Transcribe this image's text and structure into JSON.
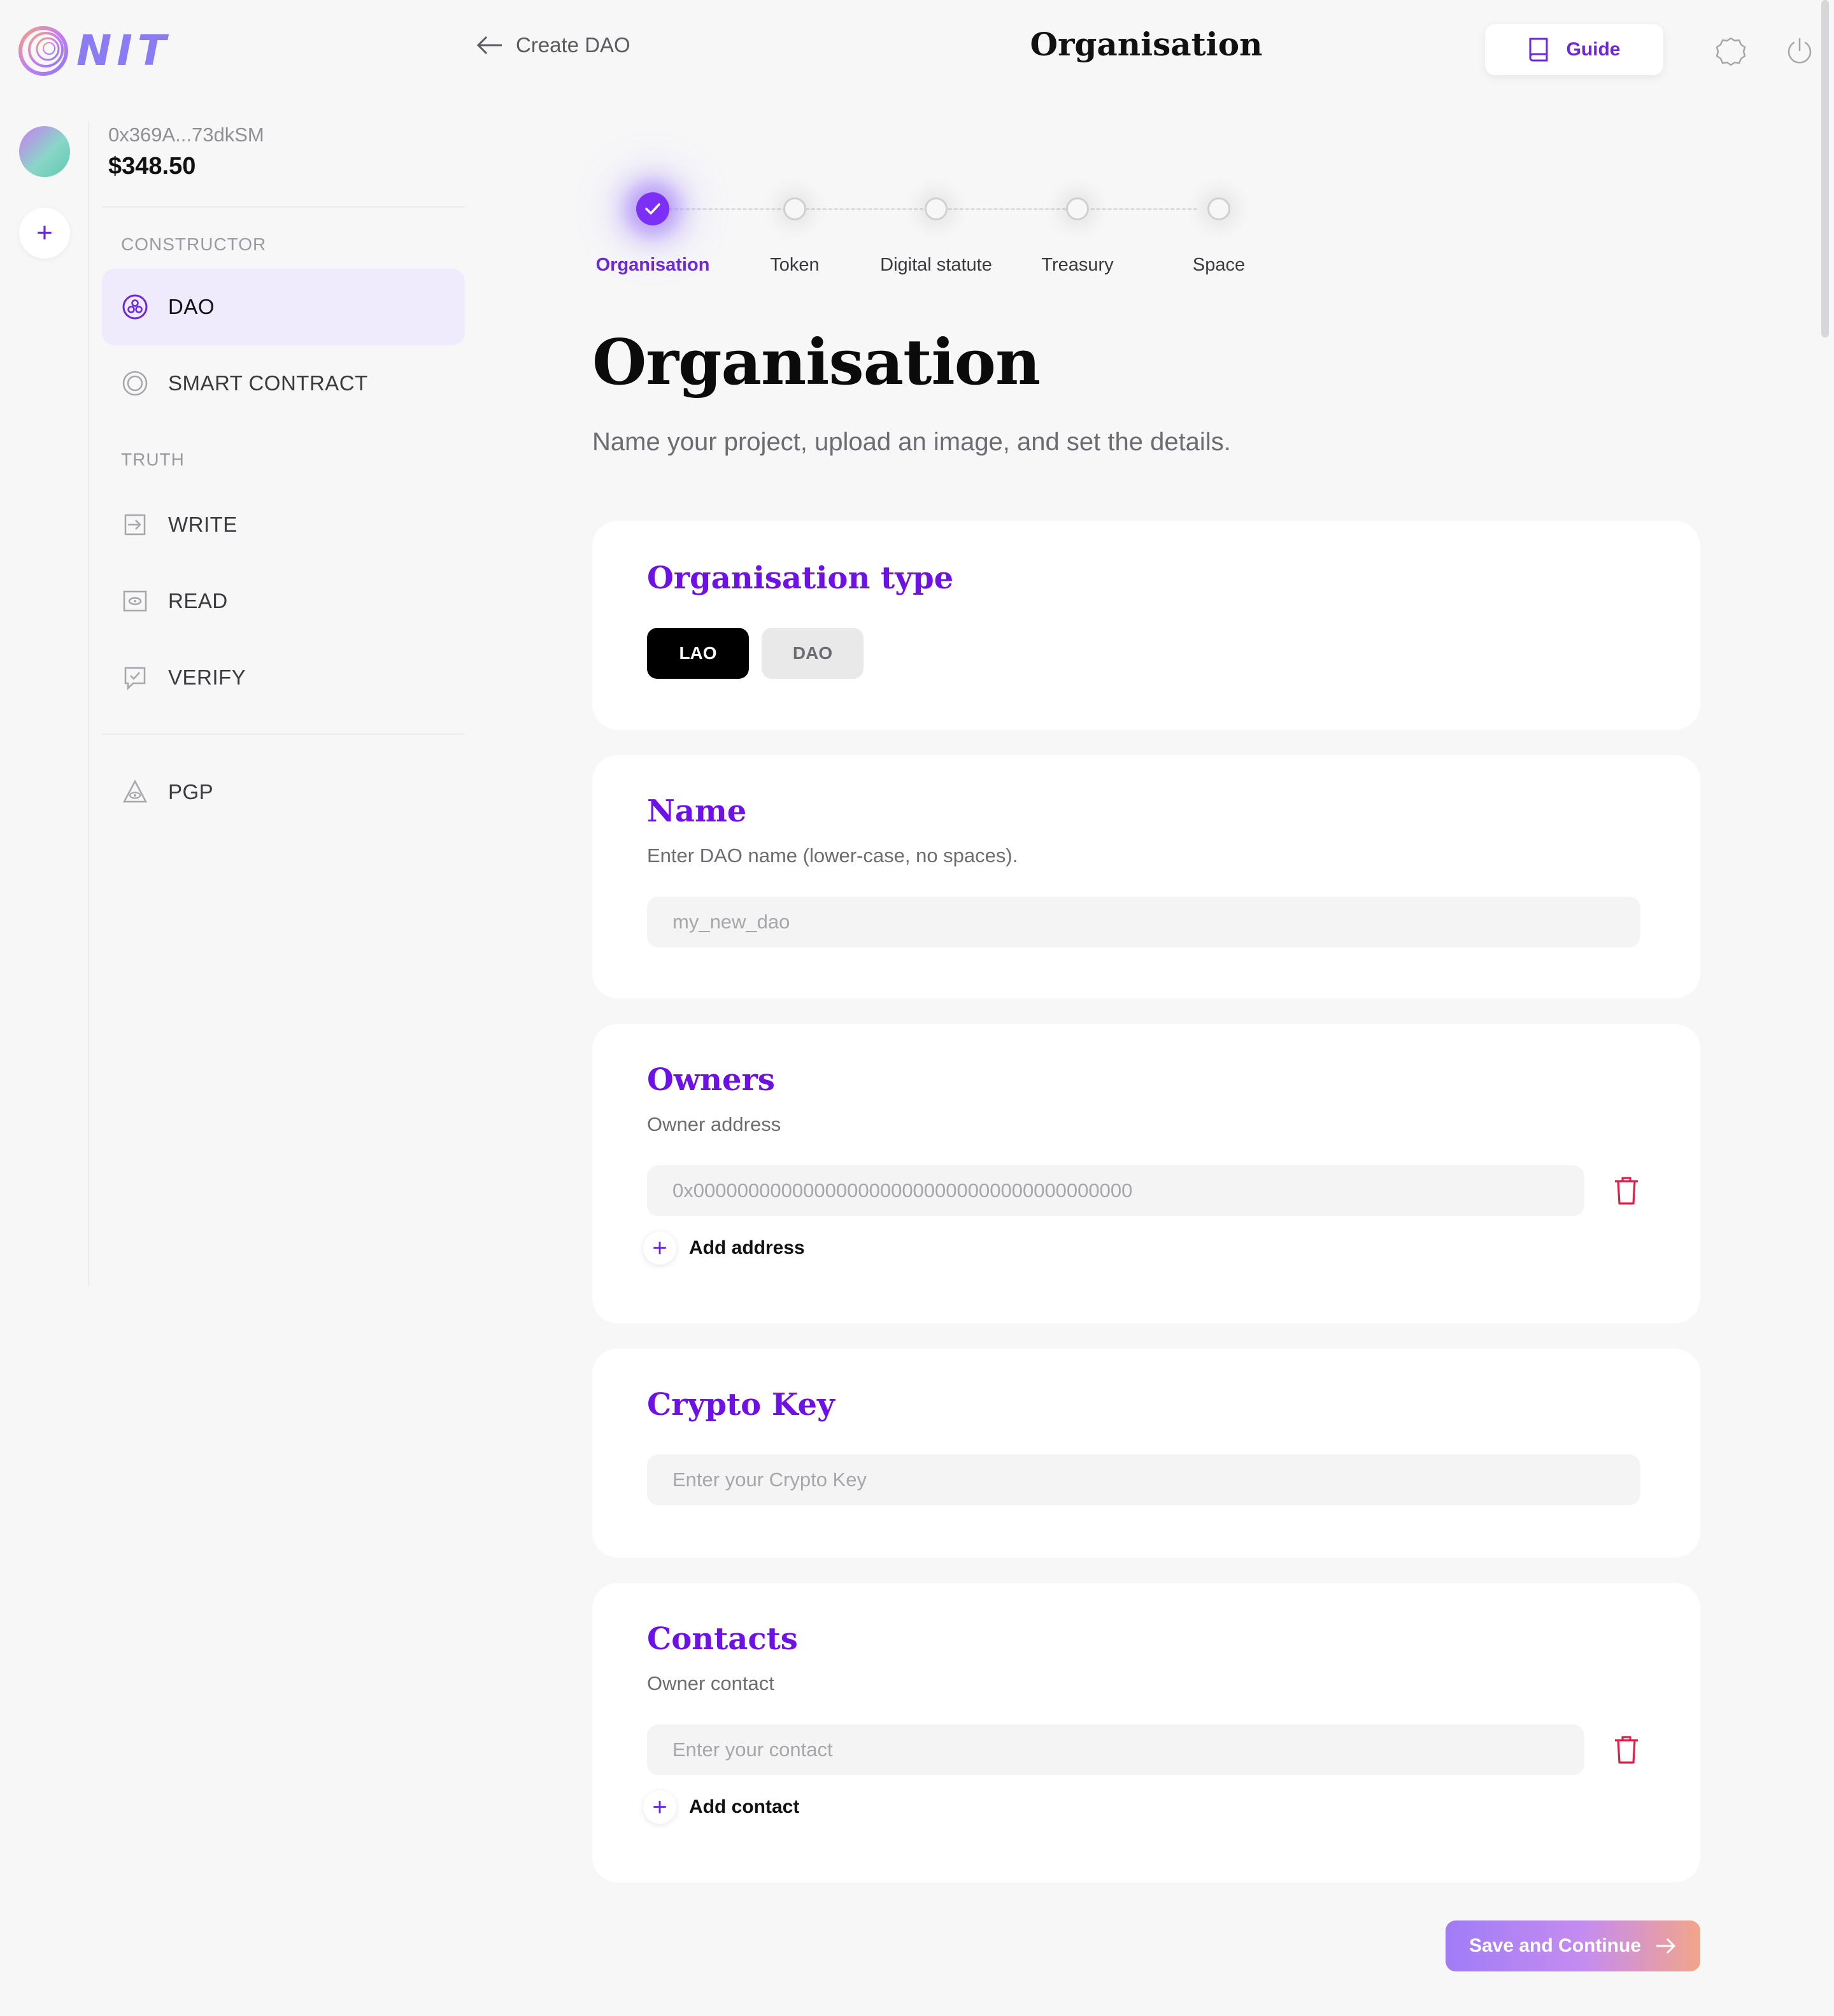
{
  "app": {
    "logo_text": "NIT",
    "brand_color": "#8b7cf6",
    "accent_color": "#6d28d9"
  },
  "wallet": {
    "address": "0x369A...73dkSM",
    "balance": "$348.50"
  },
  "sidebar": {
    "constructor_label": "CONSTRUCTOR",
    "truth_label": "TRUTH",
    "items": [
      {
        "label": "DAO",
        "icon": "dao-icon",
        "active": true
      },
      {
        "label": "SMART CONTRACT",
        "icon": "smart-contract-icon"
      },
      {
        "label": "WRITE",
        "icon": "write-icon"
      },
      {
        "label": "READ",
        "icon": "read-icon"
      },
      {
        "label": "VERIFY",
        "icon": "verify-icon"
      },
      {
        "label": "PGP",
        "icon": "pgp-icon"
      }
    ]
  },
  "header": {
    "back_label": "Create DAO",
    "title": "Organisation",
    "guide_label": "Guide"
  },
  "stepper": {
    "steps": [
      {
        "label": "Organisation",
        "state": "done"
      },
      {
        "label": "Token",
        "state": "pending"
      },
      {
        "label": "Digital statute",
        "state": "pending"
      },
      {
        "label": "Treasury",
        "state": "pending"
      },
      {
        "label": "Space",
        "state": "pending"
      }
    ]
  },
  "page": {
    "heading": "Organisation",
    "subtitle": "Name your project, upload an image, and set the details."
  },
  "org_type": {
    "title": "Organisation type",
    "options": [
      "LAO",
      "DAO"
    ],
    "selected": "LAO"
  },
  "name_card": {
    "title": "Name",
    "description": "Enter DAO name (lower-case, no spaces).",
    "placeholder": "my_new_dao",
    "value": ""
  },
  "owners_card": {
    "title": "Owners",
    "description": "Owner address",
    "placeholder": "0x0000000000000000000000000000000000000000",
    "value": "",
    "add_label": "Add address"
  },
  "crypto_key_card": {
    "title": "Crypto Key",
    "placeholder": "Enter your Crypto Key",
    "value": ""
  },
  "contacts_card": {
    "title": "Contacts",
    "description": "Owner contact",
    "placeholder": "Enter your contact",
    "value": "",
    "add_label": "Add contact"
  },
  "footer": {
    "save_label": "Save and Continue"
  }
}
